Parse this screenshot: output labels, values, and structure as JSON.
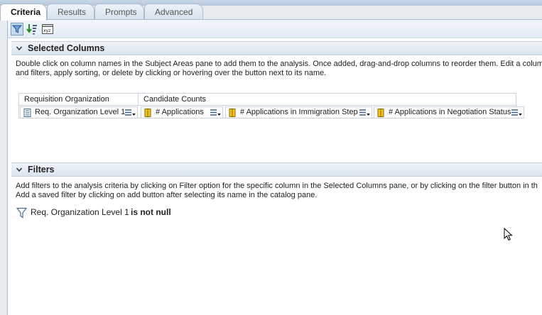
{
  "tabs": [
    {
      "label": "Criteria"
    },
    {
      "label": "Results"
    },
    {
      "label": "Prompts"
    },
    {
      "label": "Advanced"
    }
  ],
  "toolbar": {
    "icons": [
      "filter-toggle-icon",
      "sort-icon",
      "column-properties-icon"
    ]
  },
  "selected_columns": {
    "title": "Selected Columns",
    "description_line1": "Double click on column names in the Subject Areas pane to add them to the analysis. Once added, drag-and-drop columns to reorder them. Edit a colum",
    "description_line2": "and filters, apply sorting, or delete by clicking or hovering over the button next to its name.",
    "groups": [
      {
        "label": "Requisition Organization"
      },
      {
        "label": "Candidate Counts"
      }
    ],
    "columns": [
      {
        "label": "Req. Organization Level 1",
        "icon": "hierarchy-column-icon"
      },
      {
        "label": "# Applications",
        "icon": "measure-column-icon"
      },
      {
        "label": "# Applications in Immigration Step",
        "icon": "measure-column-icon"
      },
      {
        "label": "# Applications in Negotiation Status",
        "icon": "measure-column-icon"
      }
    ]
  },
  "filters": {
    "title": "Filters",
    "description_line1": "Add filters to the analysis criteria by clicking on Filter option for the specific column in the Selected Columns pane, or by clicking on the filter button in th",
    "description_line2": "Add a saved filter by clicking on add button after selecting its name in the catalog pane.",
    "items": [
      {
        "column": "Req. Organization Level 1",
        "operator": "is not null"
      }
    ]
  },
  "colors": {
    "tab_border": "#a9bccf",
    "header_bg": "#dbe5ef",
    "measure_icon": "#f0c419"
  }
}
